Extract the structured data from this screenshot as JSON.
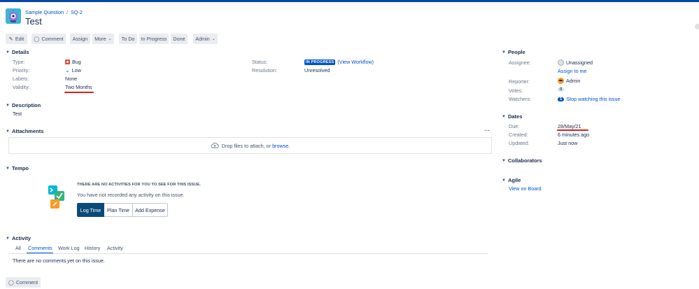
{
  "breadcrumb": {
    "project": "Sample Question",
    "separator": "/",
    "issue_key": "SQ-2"
  },
  "issue": {
    "title": "Test"
  },
  "toolbar": {
    "edit": "Edit",
    "comment": "Comment",
    "assign": "Assign",
    "more": "More",
    "todo": "To Do",
    "in_progress": "In Progress",
    "done": "Done",
    "admin": "Admin"
  },
  "details": {
    "heading": "Details",
    "type_label": "Type:",
    "type_value": "Bug",
    "priority_label": "Priority:",
    "priority_value": "Low",
    "labels_label": "Labels:",
    "labels_value": "None",
    "validity_label": "Validity:",
    "validity_value": "Two Months",
    "status_label": "Status:",
    "status_value": "IN PROGRESS",
    "view_workflow": "(View Workflow)",
    "resolution_label": "Resolution:",
    "resolution_value": "Unresolved"
  },
  "description": {
    "heading": "Description",
    "text": "Test"
  },
  "attachments": {
    "heading": "Attachments",
    "more": "···",
    "drop_text": "Drop files to attach, or",
    "browse": "browse."
  },
  "tempo": {
    "heading": "Tempo",
    "no_activities": "THERE ARE NO ACTIVITIES FOR YOU TO SEE FOR THIS ISSUE.",
    "not_recorded": "You have not recorded any activity on this issue.",
    "log_time": "Log Time",
    "plan_time": "Plan Time",
    "add_expense": "Add Expense"
  },
  "activity": {
    "heading": "Activity",
    "tabs": [
      "All",
      "Comments",
      "Work Log",
      "History",
      "Activity"
    ],
    "active_tab": "Comments",
    "empty": "There are no comments yet on this issue.",
    "comment_button": "Comment"
  },
  "people": {
    "heading": "People",
    "assignee_label": "Assignee:",
    "assignee_value": "Unassigned",
    "assign_to_me": "Assign to me",
    "reporter_label": "Reporter:",
    "reporter_value": "Admin",
    "votes_label": "Votes:",
    "votes_value": "0",
    "watchers_label": "Watchers:",
    "watchers_count": "1",
    "stop_watching": "Stop watching this issue"
  },
  "dates": {
    "heading": "Dates",
    "due_label": "Due:",
    "due_value": "28/May/21",
    "created_label": "Created:",
    "created_value": "6 minutes ago",
    "updated_label": "Updated:",
    "updated_value": "Just now"
  },
  "collaborators": {
    "heading": "Collaborators"
  },
  "agile": {
    "heading": "Agile",
    "view_on_board": "View on Board"
  },
  "colors": {
    "link": "#0052cc",
    "annotation": "#e01e1e",
    "bug": "#e5493a",
    "status_lozenge": "#0052cc"
  }
}
